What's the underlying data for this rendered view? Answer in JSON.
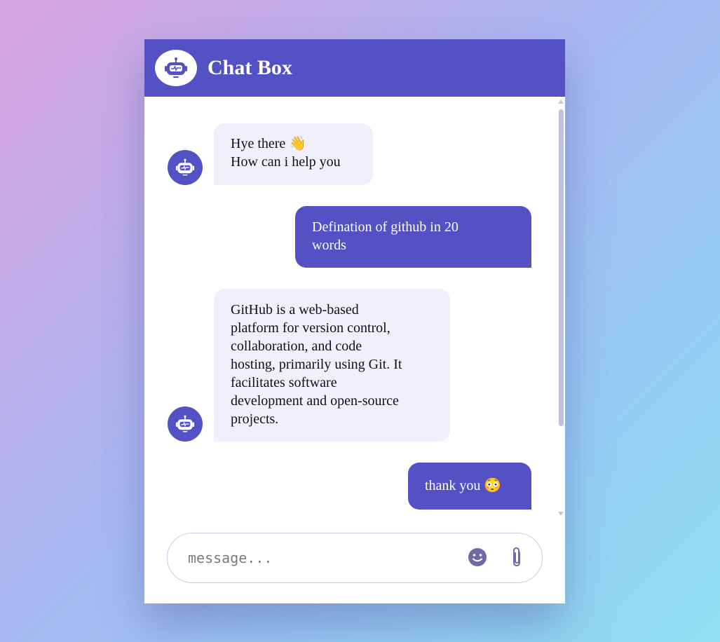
{
  "header": {
    "title": "Chat Box",
    "avatar_icon": "robot-icon"
  },
  "messages": [
    {
      "sender": "bot",
      "lines": [
        "Hye there 👋",
        "How can i help you"
      ]
    },
    {
      "sender": "user",
      "lines": [
        "Defination of github in 20",
        "words"
      ]
    },
    {
      "sender": "bot",
      "lines": [
        "GitHub is a web-based",
        "platform for version control,",
        "collaboration, and code",
        "hosting, primarily using Git. It",
        "facilitates software",
        "development and open-source",
        "projects."
      ]
    },
    {
      "sender": "user",
      "lines": [
        "thank you 😳"
      ]
    }
  ],
  "composer": {
    "placeholder": "message...",
    "emoji_icon": "smiley-icon",
    "attach_icon": "paperclip-icon"
  },
  "colors": {
    "accent": "#5351c4",
    "bot_bubble": "#f0f0fc"
  }
}
